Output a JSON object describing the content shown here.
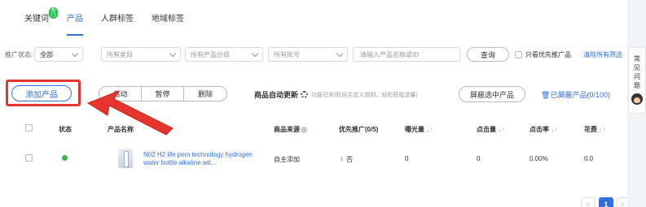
{
  "tabs": [
    {
      "label": "关键词",
      "badge": "热门"
    },
    {
      "label": "产品"
    },
    {
      "label": "人群标签"
    },
    {
      "label": "地域标签"
    }
  ],
  "filters": {
    "status_label": "推广状态:",
    "status_value": "全部",
    "category_placeholder": "所有类目",
    "group_placeholder": "所有产品分组",
    "account_placeholder": "所有账号",
    "keyword_placeholder": "请输入产品名称或ID",
    "query_label": "查询",
    "priority_only_label": "只看优先推广品",
    "clear_label": "清除所有筛选"
  },
  "actions": {
    "add_product": "添加产品",
    "start": "启动",
    "pause": "暂停",
    "delete": "删除",
    "auto_update_label": "商品自动更新",
    "auto_update_hint": "功能已关闭(自主定义规则，轻松获取流量)",
    "block_selected": "屏蔽选中产品",
    "blocked_products": "已屏蔽产品(0/100)"
  },
  "table": {
    "headers": {
      "status": "状态",
      "name": "产品名称",
      "source": "商品来源",
      "priority": "优先推广(0/5)",
      "impressions": "曝光量",
      "clicks": "点击量",
      "ctr": "点击率",
      "cost": "花费"
    },
    "rows": [
      {
        "status": "active",
        "name": "N02 H2 life pem technology hydrogen water bottle alkaline wit...",
        "source": "自主添加",
        "priority": "否",
        "impressions": "0",
        "clicks": "0",
        "ctr": "0.00%",
        "cost": "0.0"
      }
    ]
  },
  "pagination": {
    "current": "1",
    "prev": "<",
    "next": ">"
  },
  "help_float": {
    "chars": [
      "常",
      "见",
      "问",
      "题"
    ]
  },
  "colors": {
    "accent": "#2f6fe0",
    "annotation_red": "#e6352c",
    "status_green": "#3cb44b"
  }
}
